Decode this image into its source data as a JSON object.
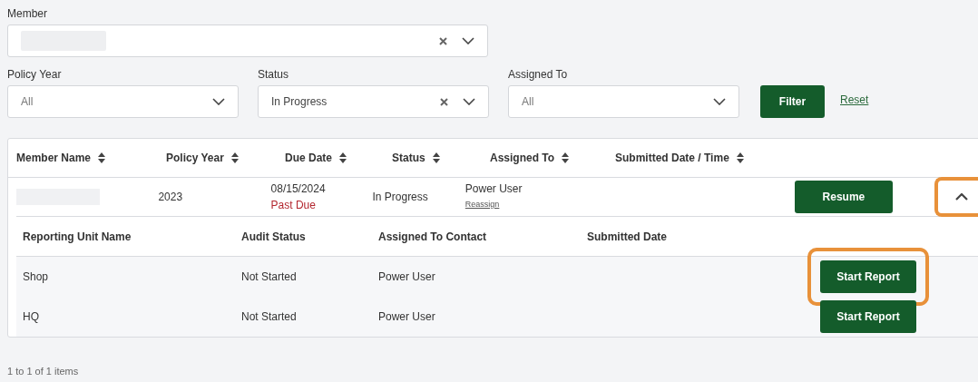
{
  "filters": {
    "member": {
      "label": "Member",
      "value_hidden": true,
      "clearable": true
    },
    "policy_year": {
      "label": "Policy Year",
      "value": "All",
      "clearable": false
    },
    "status": {
      "label": "Status",
      "value": "In Progress",
      "clearable": true
    },
    "assigned_to": {
      "label": "Assigned To",
      "value": "All",
      "clearable": false
    },
    "filter_button": "Filter",
    "reset_link": "Reset"
  },
  "table": {
    "columns": [
      "Member Name",
      "Policy Year",
      "Due Date",
      "Status",
      "Assigned To",
      "Submitted Date / Time"
    ],
    "rows": [
      {
        "member_name_hidden": true,
        "policy_year": "2023",
        "due_date": "08/15/2024",
        "due_note": "Past Due",
        "status": "In Progress",
        "assigned_to": "Power User",
        "reassign_link": "Reassign",
        "action": "Resume",
        "expanded": true,
        "expand_highlighted": true,
        "sub_table": {
          "columns": [
            "Reporting Unit Name",
            "Audit Status",
            "Assigned To Contact",
            "Submitted Date"
          ],
          "rows": [
            {
              "unit": "Shop",
              "audit_status": "Not Started",
              "contact": "Power User",
              "action": "Start Report",
              "highlighted": true
            },
            {
              "unit": "HQ",
              "audit_status": "Not Started",
              "contact": "Power User",
              "action": "Start Report",
              "highlighted": false
            }
          ]
        }
      }
    ]
  },
  "pager": "1 to 1 of 1 items"
}
